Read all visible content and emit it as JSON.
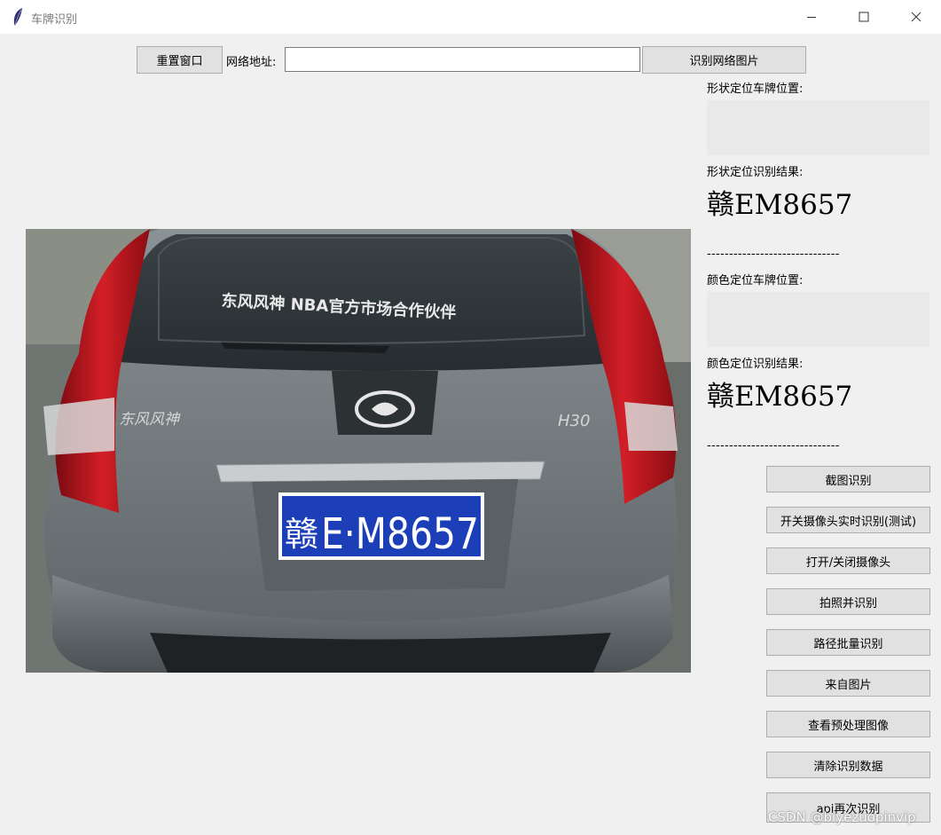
{
  "window": {
    "title": "车牌识别",
    "controls": [
      "minimize-icon",
      "maximize-icon",
      "close-icon"
    ]
  },
  "toolbar": {
    "reset_label": "重置窗口",
    "url_label": "网络地址:",
    "url_value": "",
    "recognize_url_label": "识别网络图片"
  },
  "shape": {
    "position_label": "形状定位车牌位置:",
    "result_label": "形状定位识别结果:",
    "result_value": "赣EM8657"
  },
  "color": {
    "position_label": "颜色定位车牌位置:",
    "result_label": "颜色定位识别结果:",
    "result_value": "赣EM8657"
  },
  "separator": "------------------------------",
  "image": {
    "rear_window_text": "东风风神 NBA官方市场合作伙伴",
    "brand_badge": "东风风神",
    "model_badge": "H30",
    "plate_province": "赣",
    "plate_number": "E·M8657"
  },
  "actions": [
    {
      "label": "截图识别"
    },
    {
      "label": "开关摄像头实时识别(测试)"
    },
    {
      "label": "打开/关闭摄像头"
    },
    {
      "label": "拍照并识别"
    },
    {
      "label": "路径批量识别"
    },
    {
      "label": "来自图片"
    },
    {
      "label": "查看预处理图像"
    },
    {
      "label": "清除识别数据"
    },
    {
      "label": "api再次识别"
    }
  ],
  "watermark": "CSDN @biyezuopinvip",
  "colors": {
    "background": "#f0f0f0",
    "button": "#e1e1e1",
    "button_border": "#adadad",
    "plate_blue": "#1c3fb8",
    "plate_text": "#ffffff"
  }
}
